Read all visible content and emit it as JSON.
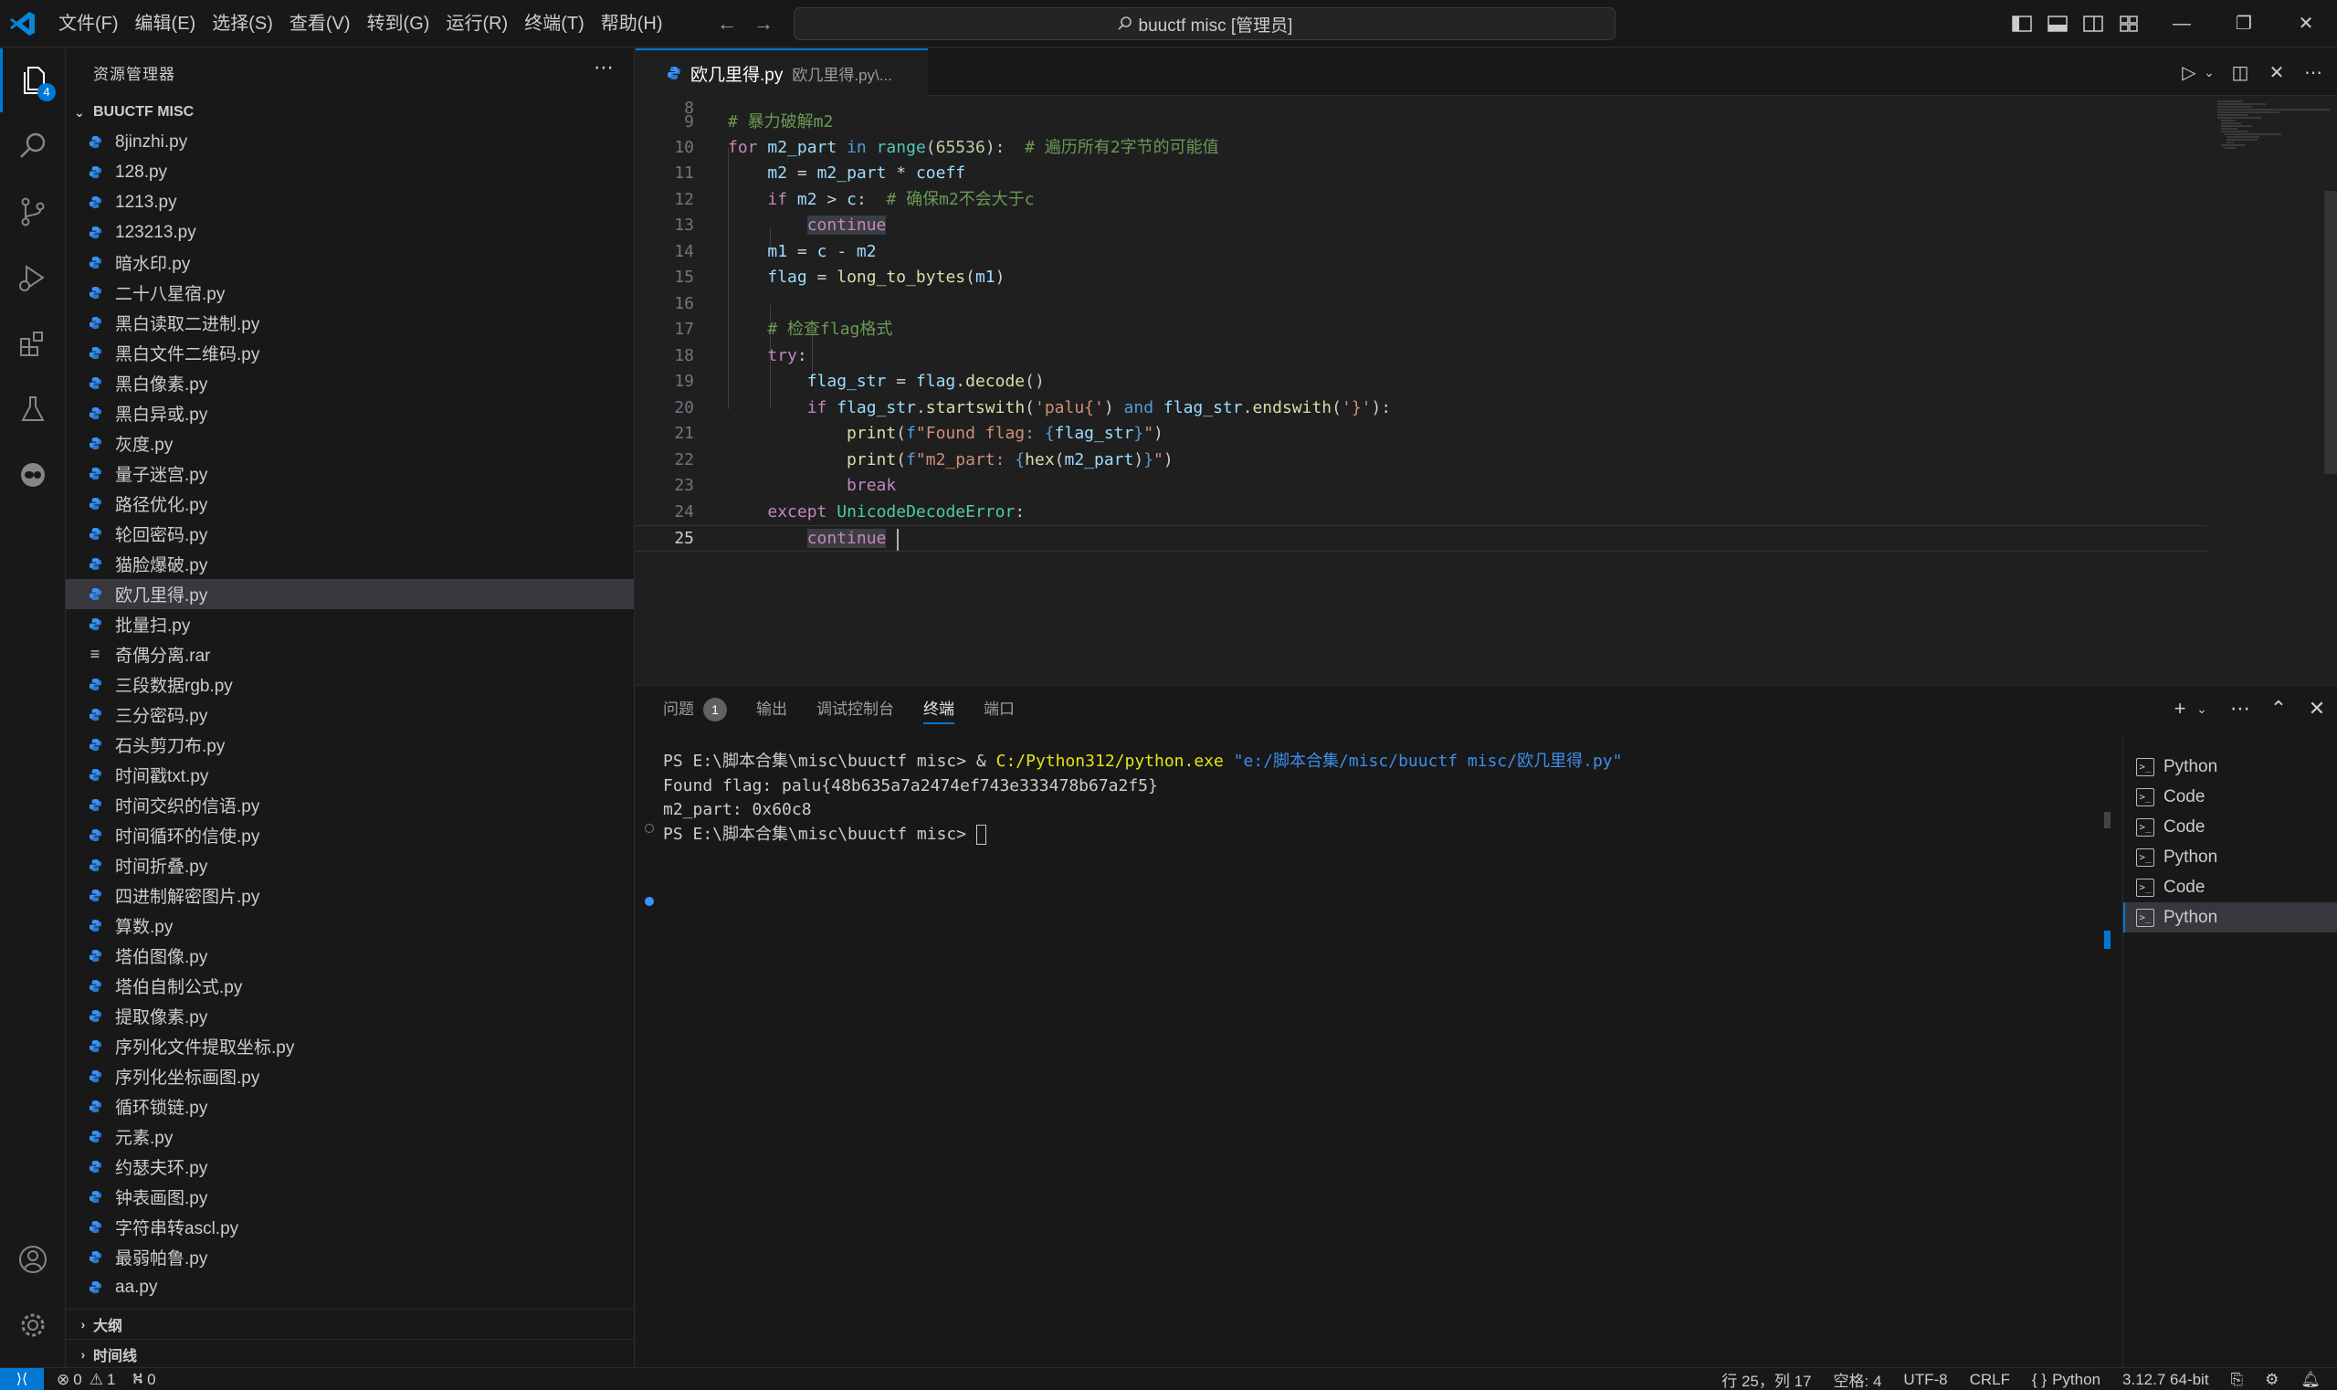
{
  "menu": [
    "文件(F)",
    "编辑(E)",
    "选择(S)",
    "查看(V)",
    "转到(G)",
    "运行(R)",
    "终端(T)",
    "帮助(H)"
  ],
  "command_center": "buuctf misc [管理员]",
  "activity": {
    "explorer_badge": "4"
  },
  "sidebar": {
    "title": "资源管理器",
    "folder": "BUUCTF MISC",
    "files": [
      "8jinzhi.py",
      "128.py",
      "1213.py",
      "123213.py",
      "暗水印.py",
      "二十八星宿.py",
      "黑白读取二进制.py",
      "黑白文件二维码.py",
      "黑白像素.py",
      "黑白异或.py",
      "灰度.py",
      "量子迷宫.py",
      "路径优化.py",
      "轮回密码.py",
      "猫脸爆破.py",
      "欧几里得.py",
      "批量扫.py",
      "奇偶分离.rar",
      "三段数据rgb.py",
      "三分密码.py",
      "石头剪刀布.py",
      "时间戳txt.py",
      "时间交织的信语.py",
      "时间循环的信使.py",
      "时间折叠.py",
      "四进制解密图片.py",
      "算数.py",
      "塔伯图像.py",
      "塔伯自制公式.py",
      "提取像素.py",
      "序列化文件提取坐标.py",
      "序列化坐标画图.py",
      "循环锁链.py",
      "元素.py",
      "约瑟夫环.py",
      "钟表画图.py",
      "字符串转ascl.py",
      "最弱帕鲁.py",
      "aa.py"
    ],
    "selected_file": "欧几里得.py",
    "outline": "大纲",
    "timeline": "时间线"
  },
  "editor": {
    "tab_name": "欧几里得.py",
    "tab_desc": "欧几里得.py\\...",
    "active_line": "25"
  },
  "panel": {
    "tabs": [
      "问题",
      "输出",
      "调试控制台",
      "终端",
      "端口"
    ],
    "problems_count": "1",
    "active_tab": "终端",
    "terminal": {
      "line1_prompt": "PS E:\\脚本合集\\misc\\buuctf misc> & ",
      "line1_exe": "C:/Python312/python.exe",
      "line1_arg": " \"e:/脚本合集/misc/buuctf misc/欧几里得.py\"",
      "line2": "Found flag: palu{48b635a7a2474ef743e333478b67a2f5}",
      "line3": "m2_part: 0x60c8",
      "line4": "PS E:\\脚本合集\\misc\\buuctf misc> "
    },
    "terminal_list": [
      "Python",
      "Code",
      "Code",
      "Python",
      "Code",
      "Python"
    ]
  },
  "status": {
    "errors": "0",
    "warnings": "1",
    "ports": "0",
    "position": "行 25，列 17",
    "spaces": "空格: 4",
    "encoding": "UTF-8",
    "eol": "CRLF",
    "language": "Python",
    "interpreter": "3.12.7 64-bit"
  },
  "colors": {
    "accent": "#0078d4",
    "python_icon": "#3794ff"
  }
}
